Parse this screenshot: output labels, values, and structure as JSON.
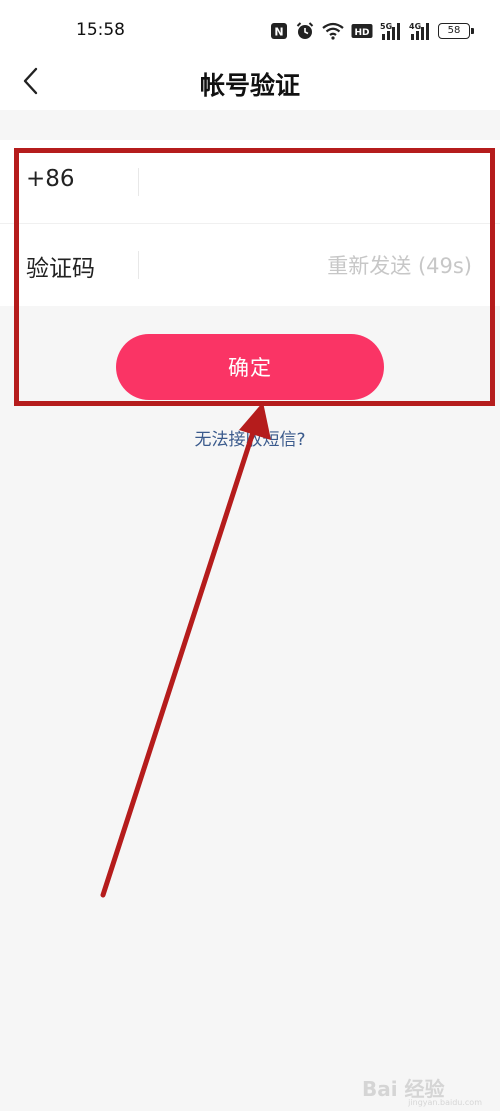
{
  "status_bar": {
    "time": "15:58",
    "battery": "58",
    "icons": [
      "nfc-icon",
      "alarm-icon",
      "wifi-icon",
      "hd-icon",
      "signal-5g-icon",
      "signal-4g-icon",
      "battery-icon"
    ],
    "nfc_glyph": "N",
    "hd_glyph": "HD",
    "sig1_label": "5G",
    "sig2_label": "4G"
  },
  "nav": {
    "title": "帐号验证",
    "back_icon": "chevron-left-icon"
  },
  "form": {
    "phone_label": "+86",
    "phone_value": "",
    "code_label": "验证码",
    "code_value": "",
    "resend_text": "重新发送 (49s)"
  },
  "confirm": {
    "label": "确定"
  },
  "sms_link": {
    "text": "无法接收短信?"
  },
  "watermark": {
    "text": "Bai 经验",
    "url": "jingyan.baidu.com"
  },
  "colors": {
    "primary": "#fa3465",
    "link": "#3a5a8c",
    "annotation": "#b51c1c",
    "background": "#f6f6f6"
  }
}
